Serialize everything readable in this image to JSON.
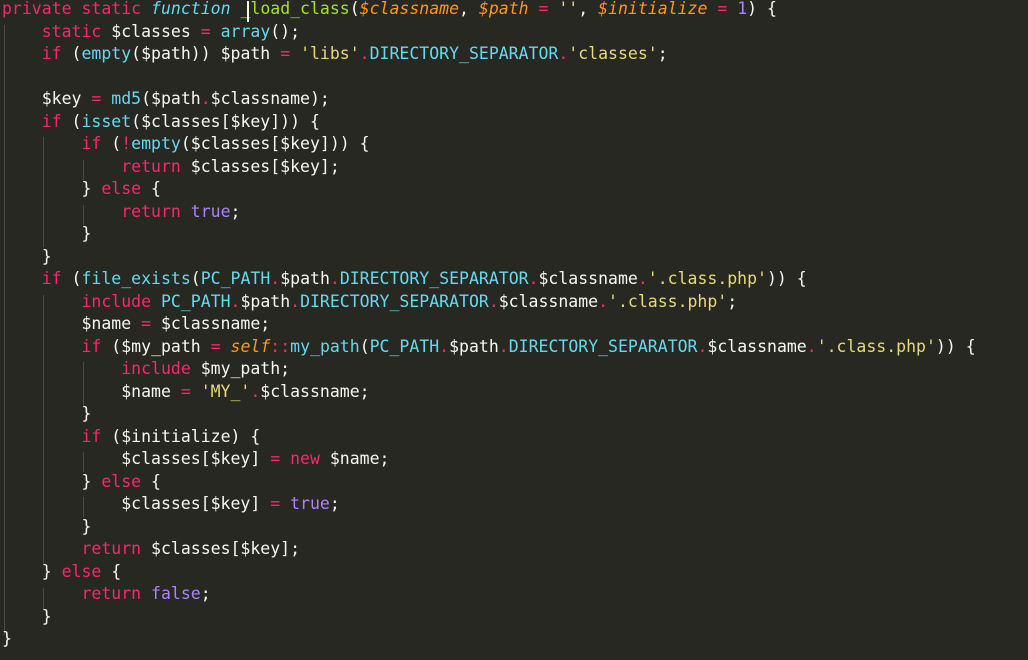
{
  "editor": {
    "theme_colors": {
      "background": "#272822",
      "foreground": "#F8F8F2",
      "keyword": "#F92672",
      "storage": "#66D9EF",
      "function_name": "#A6E22E",
      "parameter": "#FD971F",
      "string": "#E6DB74",
      "number": "#AE81FF"
    },
    "lines": [
      [
        [
          "kw",
          "private"
        ],
        [
          "pl",
          " "
        ],
        [
          "kw",
          "static"
        ],
        [
          "pl",
          " "
        ],
        [
          "st",
          "function"
        ],
        [
          "pl",
          " "
        ],
        [
          "fn",
          "_load_class"
        ],
        [
          "pl",
          "("
        ],
        [
          "pr",
          "$classname"
        ],
        [
          "pl",
          ", "
        ],
        [
          "pr",
          "$path"
        ],
        [
          "pl",
          " "
        ],
        [
          "kw",
          "="
        ],
        [
          "pl",
          " "
        ],
        [
          "str",
          "''"
        ],
        [
          "pl",
          ", "
        ],
        [
          "pr",
          "$initialize"
        ],
        [
          "pl",
          " "
        ],
        [
          "kw",
          "="
        ],
        [
          "pl",
          " "
        ],
        [
          "num",
          "1"
        ],
        [
          "pl",
          ") {"
        ]
      ],
      [
        [
          "pl",
          "    "
        ],
        [
          "kw",
          "static"
        ],
        [
          "pl",
          " $classes "
        ],
        [
          "kw",
          "="
        ],
        [
          "pl",
          " "
        ],
        [
          "bi",
          "array"
        ],
        [
          "pl",
          "();"
        ]
      ],
      [
        [
          "pl",
          "    "
        ],
        [
          "kw",
          "if"
        ],
        [
          "pl",
          " ("
        ],
        [
          "bi",
          "empty"
        ],
        [
          "pl",
          "($path)) $path "
        ],
        [
          "kw",
          "="
        ],
        [
          "pl",
          " "
        ],
        [
          "str",
          "'libs'"
        ],
        [
          "kw",
          "."
        ],
        [
          "con",
          "DIRECTORY_SEPARATOR"
        ],
        [
          "kw",
          "."
        ],
        [
          "str",
          "'classes'"
        ],
        [
          "pl",
          ";"
        ]
      ],
      [],
      [
        [
          "pl",
          "    $key "
        ],
        [
          "kw",
          "="
        ],
        [
          "pl",
          " "
        ],
        [
          "bi",
          "md5"
        ],
        [
          "pl",
          "($path"
        ],
        [
          "kw",
          "."
        ],
        [
          "pl",
          "$classname);"
        ]
      ],
      [
        [
          "pl",
          "    "
        ],
        [
          "kw",
          "if"
        ],
        [
          "pl",
          " ("
        ],
        [
          "bi",
          "isset"
        ],
        [
          "pl",
          "($classes[$key])) {"
        ]
      ],
      [
        [
          "pl",
          "        "
        ],
        [
          "kw",
          "if"
        ],
        [
          "pl",
          " ("
        ],
        [
          "kw",
          "!"
        ],
        [
          "bi",
          "empty"
        ],
        [
          "pl",
          "($classes[$key])) {"
        ]
      ],
      [
        [
          "pl",
          "            "
        ],
        [
          "kw",
          "return"
        ],
        [
          "pl",
          " $classes[$key];"
        ]
      ],
      [
        [
          "pl",
          "        } "
        ],
        [
          "kw",
          "else"
        ],
        [
          "pl",
          " {"
        ]
      ],
      [
        [
          "pl",
          "            "
        ],
        [
          "kw",
          "return"
        ],
        [
          "pl",
          " "
        ],
        [
          "ad",
          "true"
        ],
        [
          "pl",
          ";"
        ]
      ],
      [
        [
          "pl",
          "        }"
        ]
      ],
      [
        [
          "pl",
          "    }"
        ]
      ],
      [
        [
          "pl",
          "    "
        ],
        [
          "kw",
          "if"
        ],
        [
          "pl",
          " ("
        ],
        [
          "bi",
          "file_exists"
        ],
        [
          "pl",
          "("
        ],
        [
          "con",
          "PC_PATH"
        ],
        [
          "kw",
          "."
        ],
        [
          "pl",
          "$path"
        ],
        [
          "kw",
          "."
        ],
        [
          "con",
          "DIRECTORY_SEPARATOR"
        ],
        [
          "kw",
          "."
        ],
        [
          "pl",
          "$classname"
        ],
        [
          "kw",
          "."
        ],
        [
          "str",
          "'.class.php'"
        ],
        [
          "pl",
          ")) {"
        ]
      ],
      [
        [
          "pl",
          "        "
        ],
        [
          "kw",
          "include"
        ],
        [
          "pl",
          " "
        ],
        [
          "con",
          "PC_PATH"
        ],
        [
          "kw",
          "."
        ],
        [
          "pl",
          "$path"
        ],
        [
          "kw",
          "."
        ],
        [
          "con",
          "DIRECTORY_SEPARATOR"
        ],
        [
          "kw",
          "."
        ],
        [
          "pl",
          "$classname"
        ],
        [
          "kw",
          "."
        ],
        [
          "str",
          "'.class.php'"
        ],
        [
          "pl",
          ";"
        ]
      ],
      [
        [
          "pl",
          "        $name "
        ],
        [
          "kw",
          "="
        ],
        [
          "pl",
          " $classname;"
        ]
      ],
      [
        [
          "pl",
          "        "
        ],
        [
          "kw",
          "if"
        ],
        [
          "pl",
          " ($my_path "
        ],
        [
          "kw",
          "="
        ],
        [
          "pl",
          " "
        ],
        [
          "self",
          "self"
        ],
        [
          "kw",
          "::"
        ],
        [
          "bi",
          "my_path"
        ],
        [
          "pl",
          "("
        ],
        [
          "con",
          "PC_PATH"
        ],
        [
          "kw",
          "."
        ],
        [
          "pl",
          "$path"
        ],
        [
          "kw",
          "."
        ],
        [
          "con",
          "DIRECTORY_SEPARATOR"
        ],
        [
          "kw",
          "."
        ],
        [
          "pl",
          "$classname"
        ],
        [
          "kw",
          "."
        ],
        [
          "str",
          "'.class.php'"
        ],
        [
          "pl",
          ")) {"
        ]
      ],
      [
        [
          "pl",
          "            "
        ],
        [
          "kw",
          "include"
        ],
        [
          "pl",
          " $my_path;"
        ]
      ],
      [
        [
          "pl",
          "            $name "
        ],
        [
          "kw",
          "="
        ],
        [
          "pl",
          " "
        ],
        [
          "str",
          "'MY_'"
        ],
        [
          "kw",
          "."
        ],
        [
          "pl",
          "$classname;"
        ]
      ],
      [
        [
          "pl",
          "        }"
        ]
      ],
      [
        [
          "pl",
          "        "
        ],
        [
          "kw",
          "if"
        ],
        [
          "pl",
          " ($initialize) {"
        ]
      ],
      [
        [
          "pl",
          "            $classes[$key] "
        ],
        [
          "kw",
          "="
        ],
        [
          "pl",
          " "
        ],
        [
          "kw",
          "new"
        ],
        [
          "pl",
          " $name;"
        ]
      ],
      [
        [
          "pl",
          "        } "
        ],
        [
          "kw",
          "else"
        ],
        [
          "pl",
          " {"
        ]
      ],
      [
        [
          "pl",
          "            $classes[$key] "
        ],
        [
          "kw",
          "="
        ],
        [
          "pl",
          " "
        ],
        [
          "ad",
          "true"
        ],
        [
          "pl",
          ";"
        ]
      ],
      [
        [
          "pl",
          "        }"
        ]
      ],
      [
        [
          "pl",
          "        "
        ],
        [
          "kw",
          "return"
        ],
        [
          "pl",
          " $classes[$key];"
        ]
      ],
      [
        [
          "pl",
          "    } "
        ],
        [
          "kw",
          "else"
        ],
        [
          "pl",
          " {"
        ]
      ],
      [
        [
          "pl",
          "        "
        ],
        [
          "kw",
          "return"
        ],
        [
          "pl",
          " "
        ],
        [
          "ad",
          "false"
        ],
        [
          "pl",
          ";"
        ]
      ],
      [
        [
          "pl",
          "    }"
        ]
      ],
      [
        [
          "pl",
          "}"
        ]
      ]
    ]
  }
}
